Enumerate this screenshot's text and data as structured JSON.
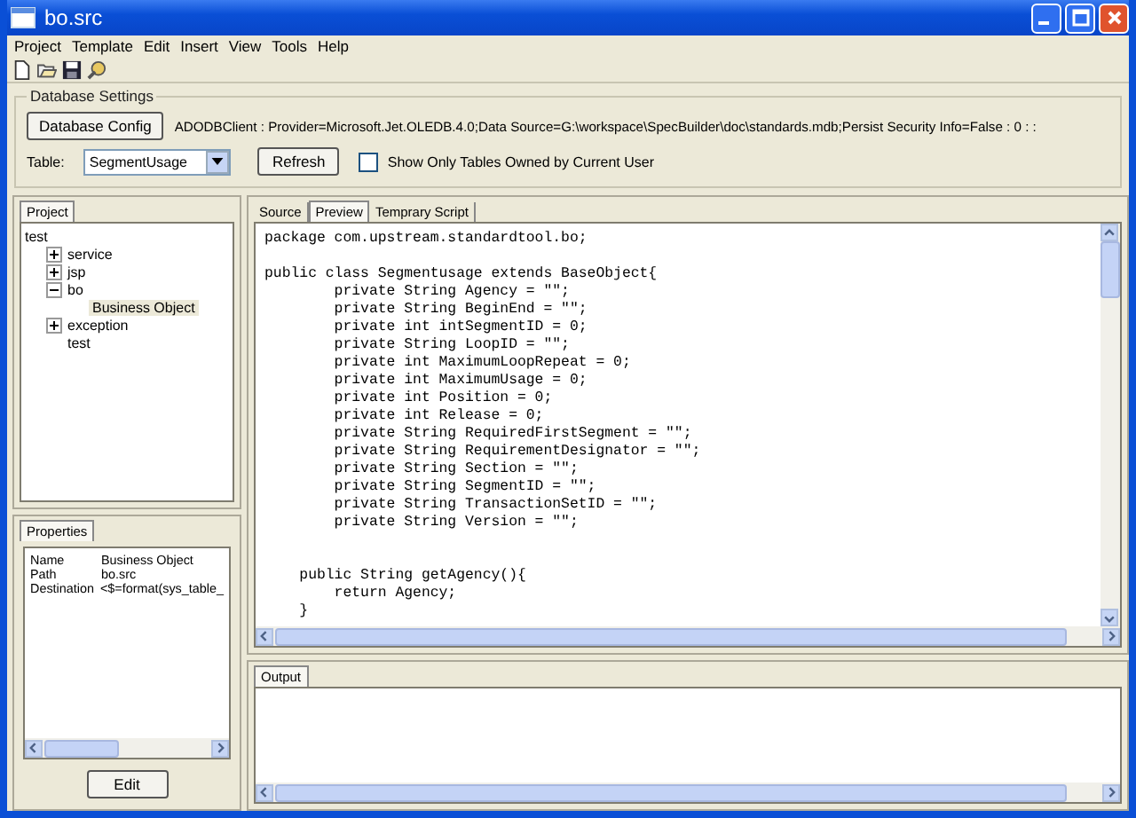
{
  "window": {
    "title": "bo.src"
  },
  "menu": [
    "Project",
    "Template",
    "Edit",
    "Insert",
    "View",
    "Tools",
    "Help"
  ],
  "database_settings": {
    "title": "Database Settings",
    "config_button": "Database Config",
    "connection_string": "ADODBClient : Provider=Microsoft.Jet.OLEDB.4.0;Data Source=G:\\workspace\\SpecBuilder\\doc\\standards.mdb;Persist Security Info=False : 0 :  :",
    "table_label": "Table:",
    "table_value": "SegmentUsage",
    "refresh_button": "Refresh",
    "owner_only": {
      "label": "Show Only Tables Owned by Current User",
      "checked": false
    }
  },
  "project_panel": {
    "tab": "Project",
    "tree": {
      "label": "test",
      "selected": false,
      "children": [
        {
          "label": "service",
          "expanded": false,
          "selected": false
        },
        {
          "label": "jsp",
          "expanded": false,
          "selected": false
        },
        {
          "label": "bo",
          "expanded": true,
          "selected": false,
          "children": [
            {
              "label": "Business Object",
              "selected": true
            }
          ]
        },
        {
          "label": "exception",
          "expanded": false,
          "selected": false
        },
        {
          "label": "test",
          "selected": false
        }
      ]
    }
  },
  "properties_panel": {
    "tab": "Properties",
    "rows": [
      {
        "name": "Name",
        "value": "Business Object"
      },
      {
        "name": "Path",
        "value": "bo.src"
      },
      {
        "name": "Destination",
        "value": "<$=format(sys_table_"
      }
    ],
    "edit_button": "Edit"
  },
  "editor": {
    "tabs": [
      {
        "label": "Source",
        "selected": false
      },
      {
        "label": "Preview",
        "selected": true
      },
      {
        "label": "Temprary Script",
        "selected": false
      }
    ],
    "code": "package com.upstream.standardtool.bo;\n\npublic class Segmentusage extends BaseObject{\n        private String Agency = \"\";\n        private String BeginEnd = \"\";\n        private int intSegmentID = 0;\n        private String LoopID = \"\";\n        private int MaximumLoopRepeat = 0;\n        private int MaximumUsage = 0;\n        private int Position = 0;\n        private int Release = 0;\n        private String RequiredFirstSegment = \"\";\n        private String RequirementDesignator = \"\";\n        private String Section = \"\";\n        private String SegmentID = \"\";\n        private String TransactionSetID = \"\";\n        private String Version = \"\";\n\n\n    public String getAgency(){\n        return Agency;\n    }"
  },
  "output_panel": {
    "tab": "Output"
  }
}
